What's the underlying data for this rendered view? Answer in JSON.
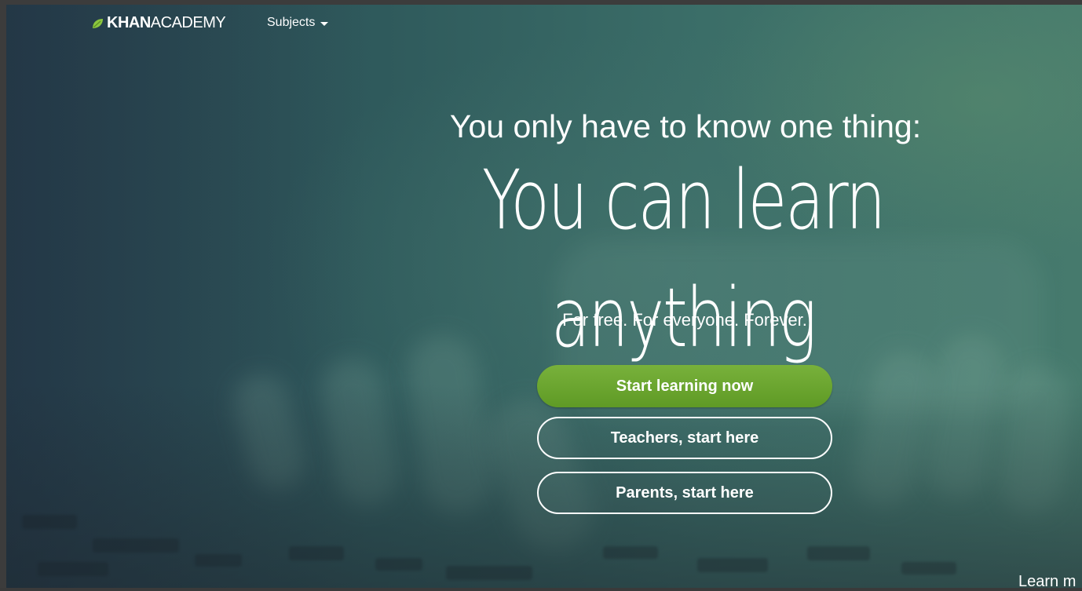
{
  "header": {
    "logo": {
      "bold": "KHAN",
      "light": "ACADEMY",
      "icon": "leaf-icon",
      "accent": "#8cc63f"
    },
    "nav": {
      "subjects_label": "Subjects",
      "icon": "chevron-down-icon"
    }
  },
  "hero": {
    "tagline": "You only have to know one thing:",
    "headline": "You can learn anything",
    "subline": "For free. For everyone. Forever."
  },
  "buttons": {
    "start_label": "Start learning now",
    "teachers_label": "Teachers, start here",
    "parents_label": "Parents, start here",
    "primary_color": "#6ba52f"
  },
  "footer": {
    "learn_more": "Learn m"
  }
}
